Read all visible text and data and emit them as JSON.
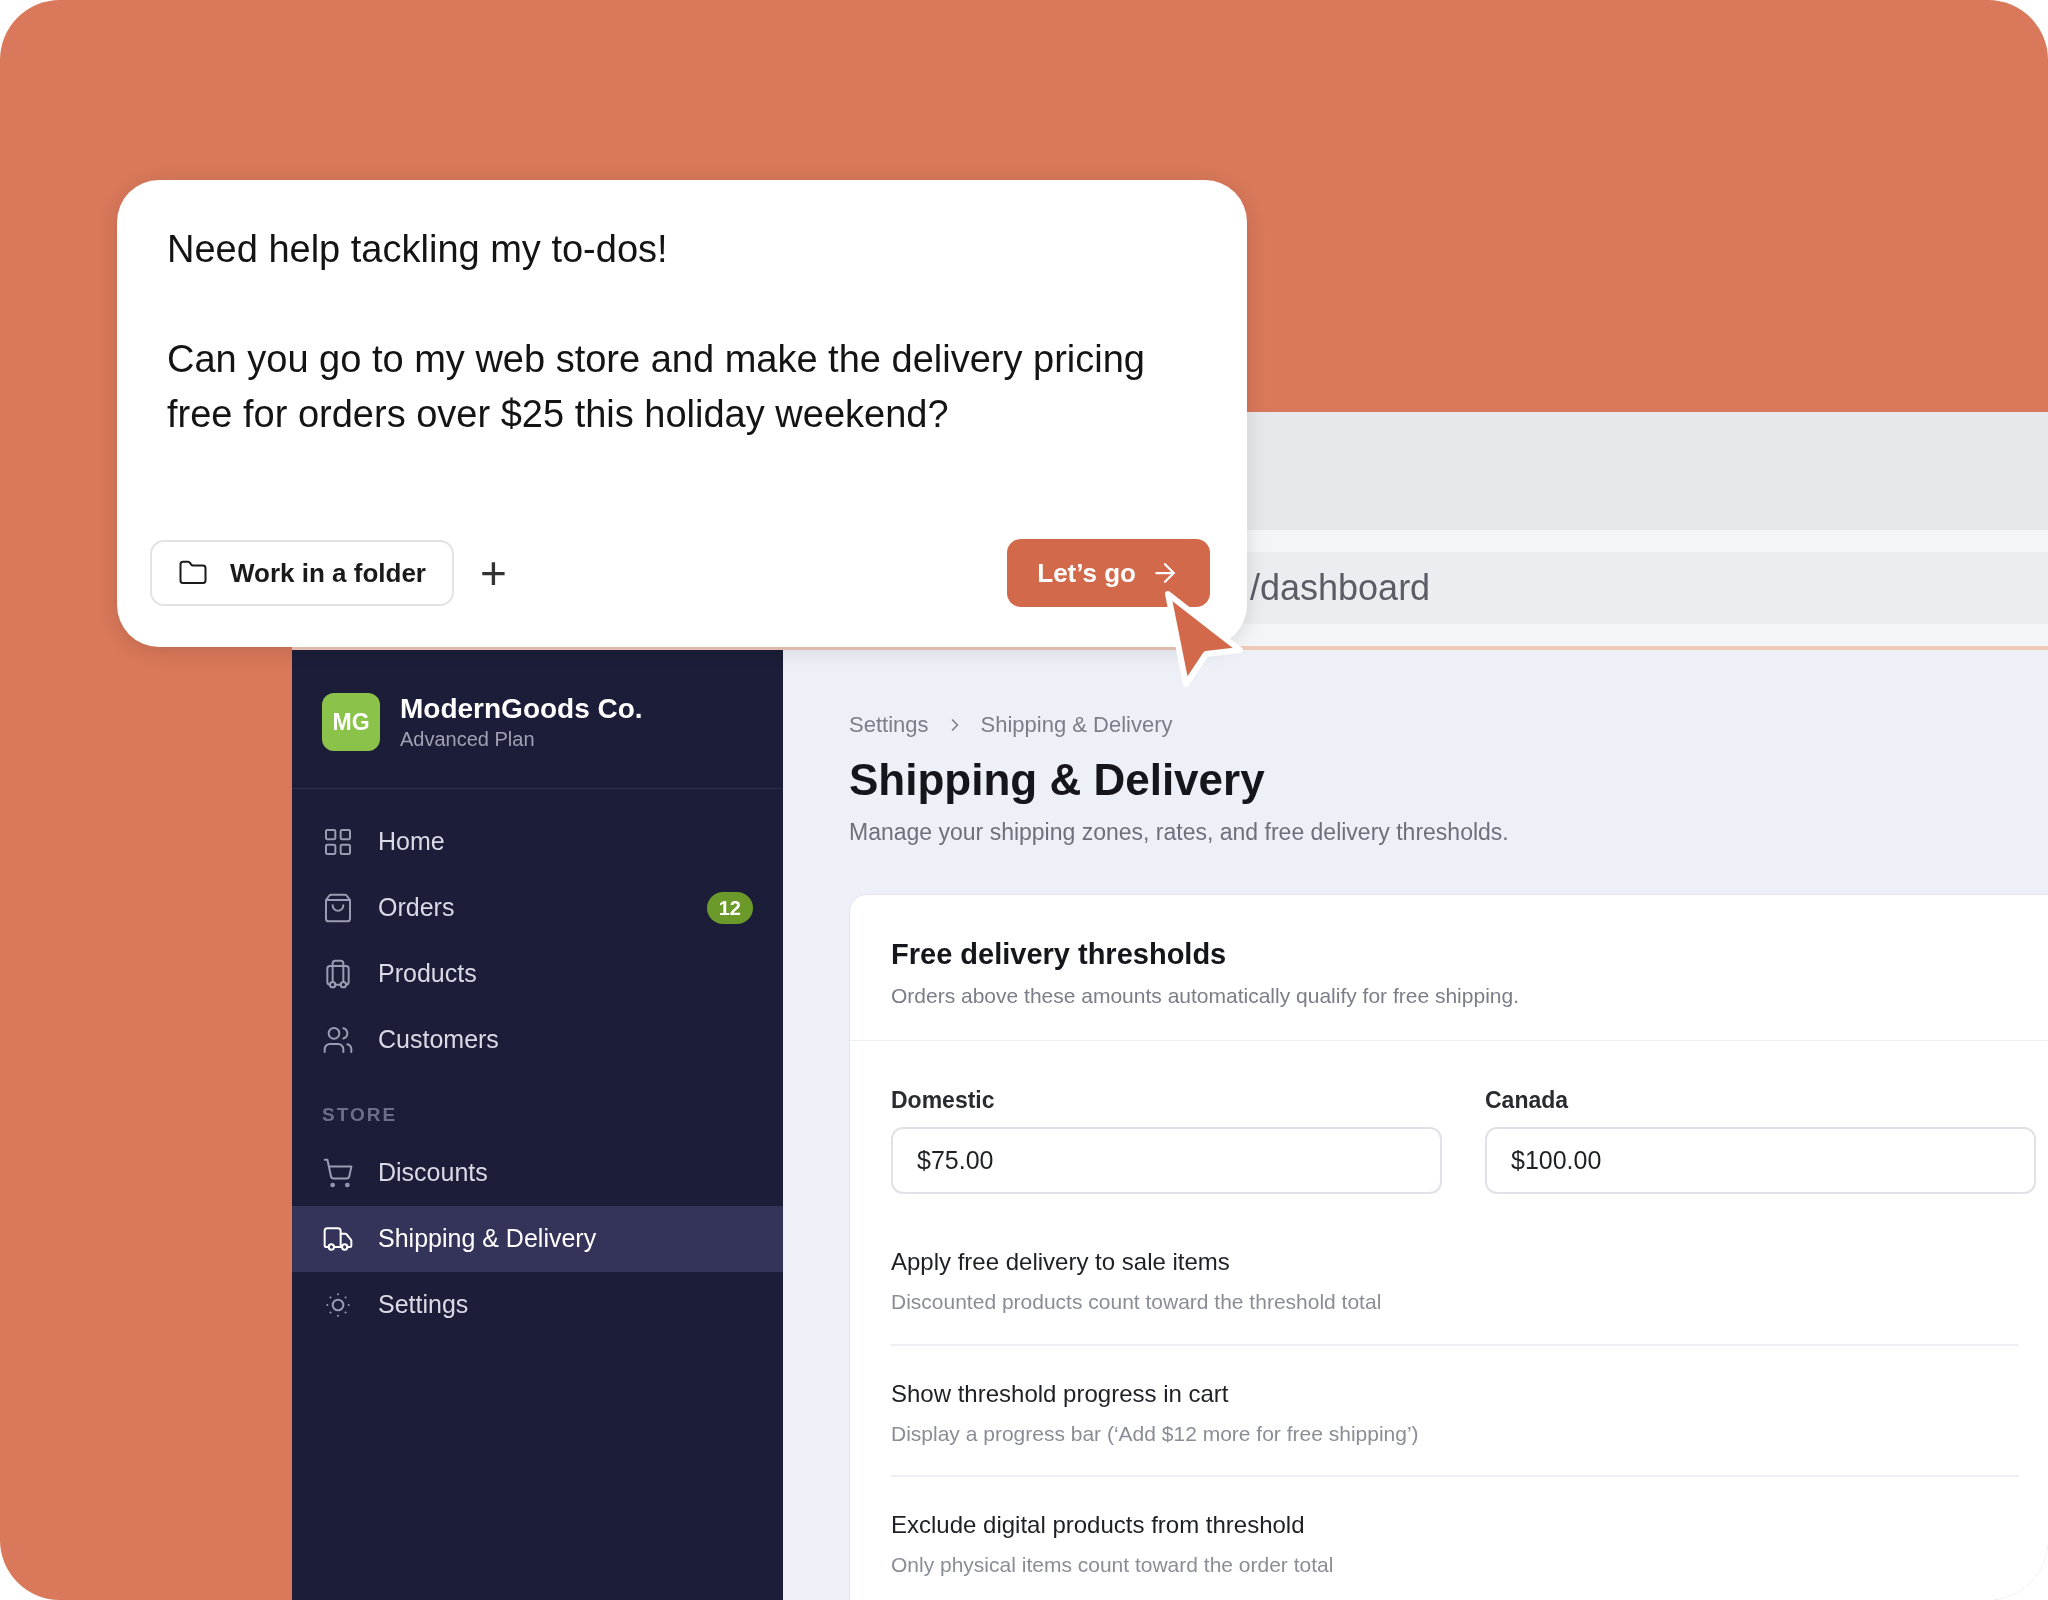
{
  "chat": {
    "paragraphs": [
      "Need help tackling my to-dos!",
      "Can you go to my web store and make the delivery pricing free for orders over $25 this holiday weekend?"
    ],
    "folder_button": "Work in a folder",
    "add_button": "+",
    "submit_button": "Let’s go"
  },
  "browser": {
    "address": "/dashboard"
  },
  "sidebar": {
    "brand": {
      "initials": "MG",
      "name": "ModernGoods Co.",
      "plan": "Advanced Plan"
    },
    "sections": [
      {
        "items": [
          {
            "kind": "grid",
            "label": "Home",
            "selected": false
          },
          {
            "kind": "bag",
            "label": "Orders",
            "badge": "12",
            "selected": false
          },
          {
            "kind": "box",
            "label": "Products",
            "selected": false
          },
          {
            "kind": "users",
            "label": "Customers",
            "selected": false
          }
        ]
      },
      {
        "heading": "STORE",
        "items": [
          {
            "kind": "cart",
            "label": "Discounts",
            "selected": false
          },
          {
            "kind": "truck",
            "label": "Shipping & Delivery",
            "selected": true
          },
          {
            "kind": "sun",
            "label": "Settings",
            "selected": false
          }
        ]
      }
    ]
  },
  "main": {
    "breadcrumb": [
      "Settings",
      "Shipping & Delivery"
    ],
    "title": "Shipping & Delivery",
    "subtitle": "Manage your shipping zones, rates, and free delivery thresholds.",
    "card": {
      "title": "Free delivery thresholds",
      "subtitle": "Orders above these amounts automatically qualify for free shipping.",
      "fields": [
        {
          "label": "Domestic",
          "value": "$75.00"
        },
        {
          "label": "Canada",
          "value": "$100.00"
        }
      ],
      "options": [
        {
          "title": "Apply free delivery to sale items",
          "description": "Discounted products count toward the threshold total"
        },
        {
          "title": "Show threshold progress in cart",
          "description": "Display a progress bar (‘Add $12 more for free shipping’)"
        },
        {
          "title": "Exclude digital products from threshold",
          "description": "Only physical items count toward the order total"
        }
      ]
    }
  }
}
